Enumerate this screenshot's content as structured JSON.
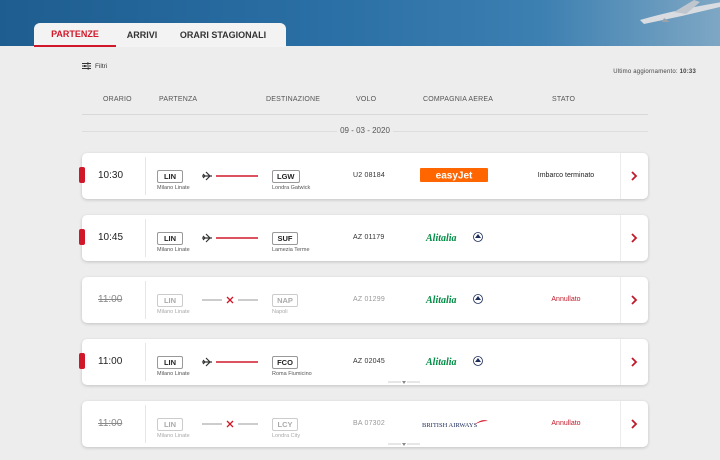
{
  "tabs": [
    {
      "label": "PARTENZE",
      "active": true
    },
    {
      "label": "ARRIVI",
      "active": false
    },
    {
      "label": "ORARI STAGIONALI",
      "active": false
    }
  ],
  "filters_label": "Filtri",
  "updated": {
    "label": "Ultimo aggiornamento:",
    "time": "10:33"
  },
  "columns": {
    "time": "ORARIO",
    "departure": "PARTENZA",
    "destination": "DESTINAZIONE",
    "flight": "VOLO",
    "airline": "COMPAGNIA AEREA",
    "status": "STATO"
  },
  "date": "09 - 03 - 2020",
  "flights": [
    {
      "time": "10:30",
      "dep_code": "LIN",
      "dep_name": "Milano Linate",
      "arr_code": "LGW",
      "arr_name": "Londra Gatwick",
      "flight": "U2 08184",
      "airline": "easyJet",
      "logo": "easyjet-logo",
      "status": "Imbarco terminato",
      "cancelled": false
    },
    {
      "time": "10:45",
      "dep_code": "LIN",
      "dep_name": "Milano Linate",
      "arr_code": "SUF",
      "arr_name": "Lamezia Terme",
      "flight": "AZ 01179",
      "airline": "Alitalia",
      "logo": "alitalia-logo",
      "status": "",
      "cancelled": false
    },
    {
      "time": "11:00",
      "dep_code": "LIN",
      "dep_name": "Milano Linate",
      "arr_code": "NAP",
      "arr_name": "Napoli",
      "flight": "AZ 01299",
      "airline": "Alitalia",
      "logo": "alitalia-logo",
      "status": "Annullato",
      "cancelled": true
    },
    {
      "time": "11:00",
      "dep_code": "LIN",
      "dep_name": "Milano Linate",
      "arr_code": "FCO",
      "arr_name": "Roma Fiumicino",
      "flight": "AZ 02045",
      "airline": "Alitalia",
      "logo": "alitalia-logo",
      "status": "",
      "cancelled": false
    },
    {
      "time": "11:00",
      "dep_code": "LIN",
      "dep_name": "Milano Linate",
      "arr_code": "LCY",
      "arr_name": "Londra City",
      "flight": "BA 07302",
      "airline": "BRITISH AIRWAYS",
      "logo": "british-airways-logo",
      "status": "Annullato",
      "cancelled": true
    }
  ],
  "colors": {
    "accent": "#d1182a",
    "easyjet": "#ff6600",
    "alitalia": "#008c45",
    "ba": "#1c2b5a"
  }
}
